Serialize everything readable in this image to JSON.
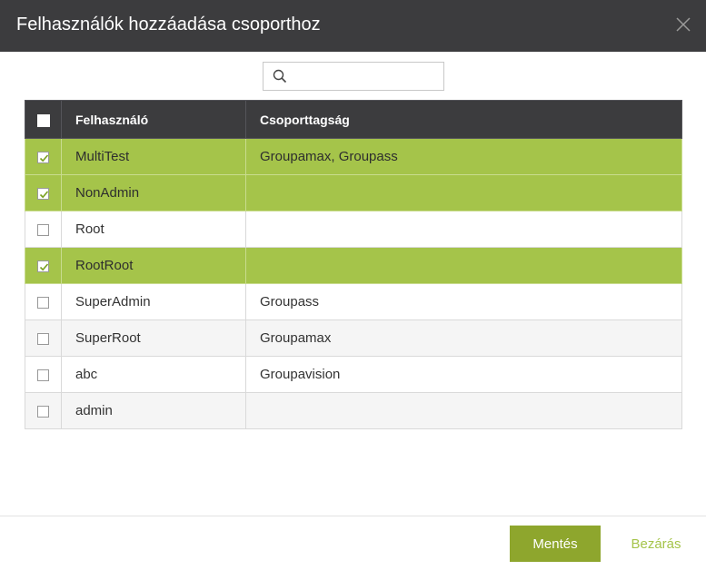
{
  "dialog": {
    "title": "Felhasználók hozzáadása csoporthoz",
    "close_icon": "close-icon"
  },
  "search": {
    "icon": "search-icon",
    "value": "",
    "placeholder": ""
  },
  "table": {
    "headers": {
      "checkbox_all": false,
      "user": "Felhasználó",
      "membership": "Csoporttagság"
    },
    "rows": [
      {
        "user": "MultiTest",
        "membership": "Groupamax, Groupass",
        "checked": true
      },
      {
        "user": "NonAdmin",
        "membership": "",
        "checked": true
      },
      {
        "user": "Root",
        "membership": "",
        "checked": false
      },
      {
        "user": "RootRoot",
        "membership": "",
        "checked": true
      },
      {
        "user": "SuperAdmin",
        "membership": "Groupass",
        "checked": false
      },
      {
        "user": "SuperRoot",
        "membership": "Groupamax",
        "checked": false
      },
      {
        "user": "abc",
        "membership": "Groupavision",
        "checked": false
      },
      {
        "user": "admin",
        "membership": "",
        "checked": false
      }
    ]
  },
  "footer": {
    "save_label": "Mentés",
    "close_label": "Bezárás"
  },
  "colors": {
    "header_bg": "#3c3c3e",
    "selected_row": "#a5c44a",
    "save_button": "#8ea62d",
    "close_link": "#a5c44a"
  }
}
